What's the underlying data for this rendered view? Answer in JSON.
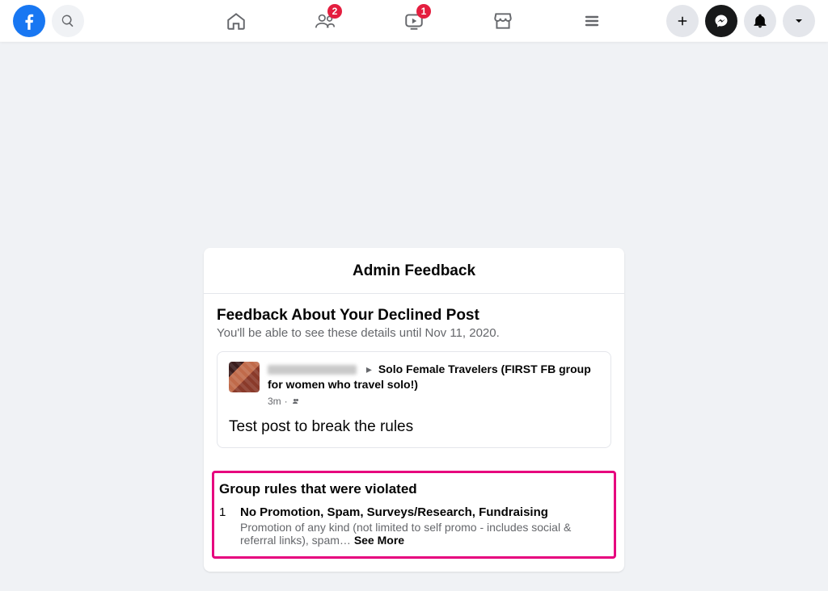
{
  "header": {
    "friends_badge": "2",
    "watch_badge": "1"
  },
  "card": {
    "title": "Admin Feedback",
    "feedback_title": "Feedback About Your Declined Post",
    "feedback_sub": "You'll be able to see these details until Nov 11, 2020.",
    "post": {
      "group_name": "Solo Female Travelers (FIRST FB group for women who travel solo!)",
      "time": "3m",
      "text": "Test post to break the rules"
    },
    "rules": {
      "title": "Group rules that were violated",
      "items": [
        {
          "num": "1",
          "name": "No Promotion, Spam, Surveys/Research, Fundraising",
          "desc": "Promotion of any kind (not limited to self promo - includes social & referral links), spam… "
        }
      ],
      "see_more": "See More"
    }
  }
}
